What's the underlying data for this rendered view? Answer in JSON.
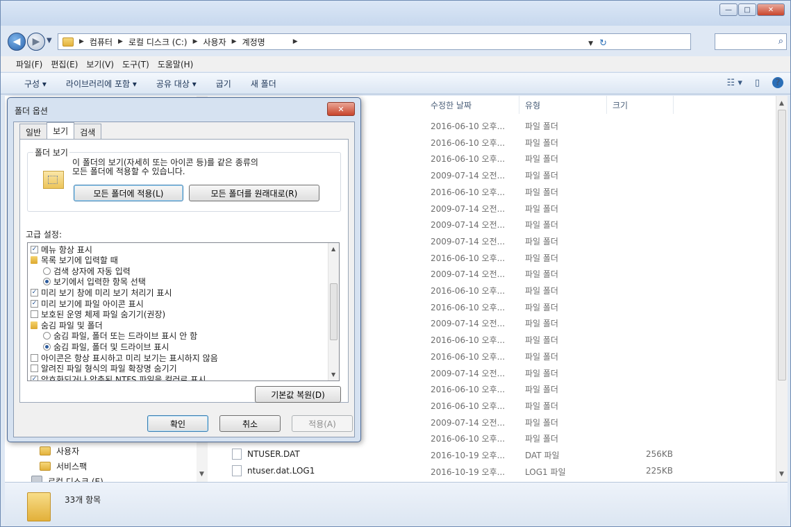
{
  "window": {
    "controls": {
      "minimize": "—",
      "maximize": "□",
      "close": "✕"
    }
  },
  "address": {
    "crumbs": [
      "컴퓨터",
      "로컬 디스크 (C:)",
      "사용자",
      "계정명"
    ],
    "search_placeholder": ""
  },
  "menu": [
    "파일(F)",
    "편집(E)",
    "보기(V)",
    "도구(T)",
    "도움말(H)"
  ],
  "toolbar": {
    "organize": "구성 ▾",
    "include_library": "라이브러리에 포함 ▾",
    "share_with": "공유 대상 ▾",
    "burn": "굽기",
    "new_folder": "새 폴더"
  },
  "columns": {
    "date": "수정한 날짜",
    "type": "유형",
    "size": "크기"
  },
  "files": [
    {
      "name": "",
      "date": "2016-06-10 오후...",
      "type": "파일 폴더",
      "size": ""
    },
    {
      "name": "",
      "date": "2016-06-10 오후...",
      "type": "파일 폴더",
      "size": ""
    },
    {
      "name": "",
      "date": "2016-06-10 오후...",
      "type": "파일 폴더",
      "size": ""
    },
    {
      "name": "",
      "date": "2009-07-14 오전...",
      "type": "파일 폴더",
      "size": ""
    },
    {
      "name": "",
      "date": "2016-06-10 오후...",
      "type": "파일 폴더",
      "size": ""
    },
    {
      "name": "",
      "date": "2009-07-14 오전...",
      "type": "파일 폴더",
      "size": ""
    },
    {
      "name": "",
      "date": "2009-07-14 오전...",
      "type": "파일 폴더",
      "size": ""
    },
    {
      "name": "",
      "date": "2009-07-14 오전...",
      "type": "파일 폴더",
      "size": ""
    },
    {
      "name": "",
      "date": "2016-06-10 오후...",
      "type": "파일 폴더",
      "size": ""
    },
    {
      "name": "",
      "date": "2009-07-14 오전...",
      "type": "파일 폴더",
      "size": ""
    },
    {
      "name": "",
      "date": "2016-06-10 오후...",
      "type": "파일 폴더",
      "size": ""
    },
    {
      "name": "",
      "date": "2016-06-10 오후...",
      "type": "파일 폴더",
      "size": ""
    },
    {
      "name": "",
      "date": "2009-07-14 오전...",
      "type": "파일 폴더",
      "size": ""
    },
    {
      "name": "",
      "date": "2016-06-10 오후...",
      "type": "파일 폴더",
      "size": ""
    },
    {
      "name": "",
      "date": "2016-06-10 오후...",
      "type": "파일 폴더",
      "size": ""
    },
    {
      "name": "",
      "date": "2009-07-14 오전...",
      "type": "파일 폴더",
      "size": ""
    },
    {
      "name": "",
      "date": "2016-06-10 오후...",
      "type": "파일 폴더",
      "size": ""
    },
    {
      "name": "",
      "date": "2016-06-10 오후...",
      "type": "파일 폴더",
      "size": ""
    },
    {
      "name": "",
      "date": "2009-07-14 오전...",
      "type": "파일 폴더",
      "size": ""
    },
    {
      "name": "",
      "date": "2016-06-10 오후...",
      "type": "파일 폴더",
      "size": ""
    },
    {
      "name": "NTUSER.DAT",
      "date": "2016-10-19 오후...",
      "type": "DAT 파일",
      "size": "256KB"
    },
    {
      "name": "ntuser.dat.LOG1",
      "date": "2016-10-19 오후...",
      "type": "LOG1 파일",
      "size": "225KB"
    }
  ],
  "nav": [
    "사용자",
    "서비스팩",
    "로컬 디스크 (E)"
  ],
  "status": {
    "count": "33개 항목"
  },
  "dialog": {
    "title": "폴더 옵션",
    "close": "✕",
    "tabs": [
      "일반",
      "보기",
      "검색"
    ],
    "group_label": "폴더 보기",
    "group_desc_1": "이 폴더의 보기(자세히 또는 아이콘 등)를 같은 종류의",
    "group_desc_2": "모든 폴더에 적용할 수 있습니다.",
    "apply_all": "모든 폴더에 적용(L)",
    "reset_all": "모든 폴더를 원래대로(R)",
    "advanced_label": "고급 설정:",
    "advanced": [
      {
        "kind": "check",
        "checked": true,
        "indent": 0,
        "label": "메뉴 항상 표시"
      },
      {
        "kind": "folder",
        "indent": 0,
        "label": "목록 보기에 입력할 때"
      },
      {
        "kind": "radio",
        "checked": false,
        "indent": 1,
        "label": "검색 상자에 자동 입력"
      },
      {
        "kind": "radio",
        "checked": true,
        "indent": 1,
        "label": "보기에서 입력한 항목 선택"
      },
      {
        "kind": "check",
        "checked": true,
        "indent": 0,
        "label": "미리 보기 창에 미리 보기 처리기 표시"
      },
      {
        "kind": "check",
        "checked": true,
        "indent": 0,
        "label": "미리 보기에 파일 아이콘 표시"
      },
      {
        "kind": "check",
        "checked": false,
        "indent": 0,
        "label": "보호된 운영 체제 파일 숨기기(권장)"
      },
      {
        "kind": "folder",
        "indent": 0,
        "label": "숨김 파일 및 폴더"
      },
      {
        "kind": "radio",
        "checked": false,
        "indent": 1,
        "label": "숨김 파일, 폴더 또는 드라이브 표시 안 함"
      },
      {
        "kind": "radio",
        "checked": true,
        "indent": 1,
        "label": "숨김 파일, 폴더 및 드라이브 표시"
      },
      {
        "kind": "check",
        "checked": false,
        "indent": 0,
        "label": "아이콘은 항상 표시하고 미리 보기는 표시하지 않음"
      },
      {
        "kind": "check",
        "checked": false,
        "indent": 0,
        "label": "알려진 파일 형식의 파일 확장명 숨기기"
      },
      {
        "kind": "check",
        "checked": true,
        "indent": 0,
        "label": "암호화되거나 압축된 NTFS 파일을 컬러로 표시"
      }
    ],
    "restore_defaults": "기본값 복원(D)",
    "ok": "확인",
    "cancel": "취소",
    "apply": "적용(A)"
  }
}
